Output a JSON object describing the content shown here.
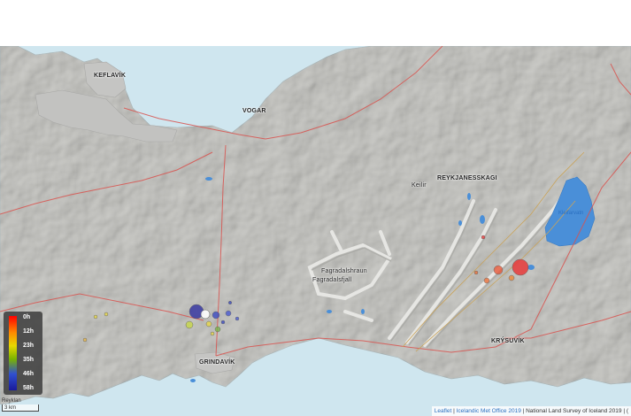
{
  "top_mark": "'",
  "places": {
    "keflavik": "KEFLAVÍK",
    "vogar": "VOGAR",
    "reykjanesskagi": "REYKJANESSKAGI",
    "keilir": "Keilir",
    "fagradalshraun": "Fagradalshraun",
    "fagradalsfjall": "Fagradalsfjall",
    "grindavik": "GRINDAVÍK",
    "krysuvik": "KRÝSUVÍK",
    "kleifarvatn": "Kleifarvatn"
  },
  "legend": {
    "labels": [
      "0h",
      "12h",
      "23h",
      "35h",
      "46h",
      "58h"
    ],
    "colors": [
      "#ff0000",
      "#ff8800",
      "#e8d800",
      "#7ab200",
      "#3050d0",
      "#1a1a9a"
    ]
  },
  "scale": {
    "top_label": "Reyklan",
    "bar_label": "3 km"
  },
  "attribution": {
    "leaflet": "Leaflet",
    "sep1": " | ",
    "met": "Icelandic Met Office 2019",
    "sep2": " | National Land Survey of Iceland 2019 | ",
    "tail": "("
  },
  "colors": {
    "sea": "#cfe6ef",
    "land": "#cfcfcb",
    "road": "#d9534f"
  }
}
